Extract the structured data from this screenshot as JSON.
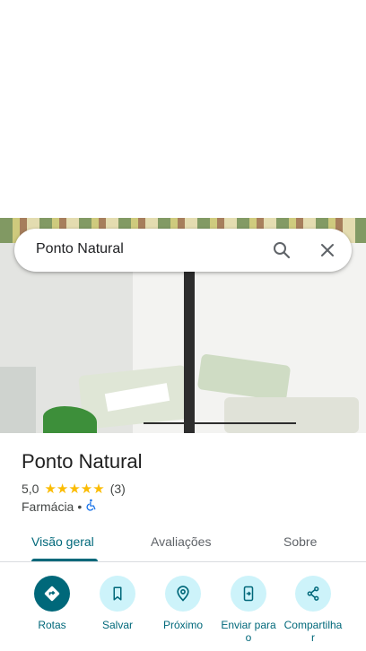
{
  "search": {
    "query": "Ponto Natural"
  },
  "place": {
    "name": "Ponto Natural",
    "rating": "5,0",
    "stars": "★★★★★",
    "review_count": "(3)",
    "category": "Farmácia",
    "separator": "•"
  },
  "tabs": [
    {
      "label": "Visão geral"
    },
    {
      "label": "Avaliações"
    },
    {
      "label": "Sobre"
    }
  ],
  "actions": [
    {
      "label": "Rotas",
      "icon": "directions-icon"
    },
    {
      "label": "Salvar",
      "icon": "bookmark-icon"
    },
    {
      "label": "Próximo",
      "icon": "nearby-icon"
    },
    {
      "label": "Enviar para o",
      "icon": "send-to-phone-icon"
    },
    {
      "label": "Compartilha r",
      "icon": "share-icon"
    }
  ],
  "colors": {
    "accent": "#00687a",
    "action_bg": "#cdf3fa",
    "star": "#fbbc04",
    "accessibility_blue": "#1a73e8"
  }
}
